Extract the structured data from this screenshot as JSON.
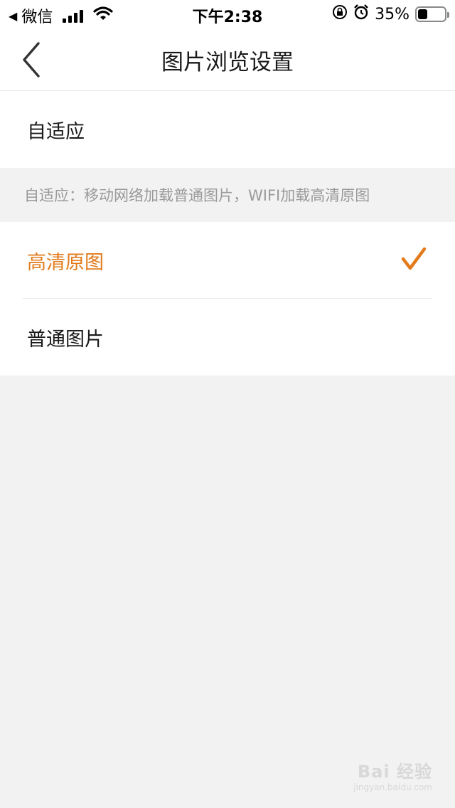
{
  "status_bar": {
    "back_arrow": "◀",
    "carrier": "微信",
    "time": "下午2:38",
    "battery_percent": "35%",
    "battery_level": 0.35,
    "icons": [
      "signal-icon",
      "wifi-icon",
      "orientation-lock-icon",
      "alarm-icon",
      "battery-icon"
    ]
  },
  "nav": {
    "title": "图片浏览设置",
    "back_icon": "chevron-left-icon"
  },
  "options": {
    "adaptive": {
      "label": "自适应"
    },
    "note": "自适应：移动网络加载普通图片，WIFI加载高清原图",
    "hd": {
      "label": "高清原图",
      "selected": true
    },
    "normal": {
      "label": "普通图片",
      "selected": false
    }
  },
  "colors": {
    "accent": "#e37b1c",
    "background": "#f2f2f2",
    "note_text": "#9a9a9a"
  },
  "watermark": {
    "main": "Bai 经验",
    "sub": "jingyan.baidu.com"
  }
}
